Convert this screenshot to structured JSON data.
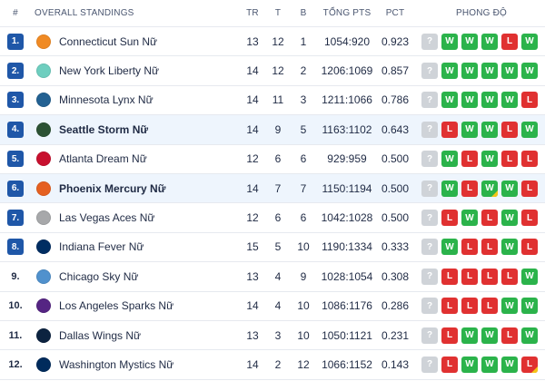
{
  "header": {
    "rank": "#",
    "title": "OVERALL STANDINGS",
    "played": "TR",
    "wins": "T",
    "losses": "B",
    "points": "TỔNG PTS",
    "pct": "PCT",
    "form": "PHONG ĐỘ"
  },
  "colors": {
    "rank_badge": "#1f57a8",
    "win": "#2bb34b",
    "loss": "#e03131",
    "unknown": "#cfd3d8",
    "highlight_row": "#eef5fd",
    "partial_marker": "#f5c518"
  },
  "teams": [
    {
      "rank": "1.",
      "badge": true,
      "name": "Connecticut Sun Nữ",
      "bold": false,
      "highlight": false,
      "logo": "sun-logo-icon",
      "logo_color": "#f08a24",
      "tr": "13",
      "t": "12",
      "b": "1",
      "pts": "1054:920",
      "pct": "0.923",
      "form": [
        "?",
        "W",
        "W",
        "W",
        "L",
        "W"
      ]
    },
    {
      "rank": "2.",
      "badge": true,
      "name": "New York Liberty Nữ",
      "bold": false,
      "highlight": false,
      "logo": "liberty-logo-icon",
      "logo_color": "#6ecebf",
      "tr": "14",
      "t": "12",
      "b": "2",
      "pts": "1206:1069",
      "pct": "0.857",
      "form": [
        "?",
        "W",
        "W",
        "W",
        "W",
        "W"
      ]
    },
    {
      "rank": "3.",
      "badge": true,
      "name": "Minnesota Lynx Nữ",
      "bold": false,
      "highlight": false,
      "logo": "lynx-logo-icon",
      "logo_color": "#236192",
      "tr": "14",
      "t": "11",
      "b": "3",
      "pts": "1211:1066",
      "pct": "0.786",
      "form": [
        "?",
        "W",
        "W",
        "W",
        "W",
        "L"
      ]
    },
    {
      "rank": "4.",
      "badge": true,
      "name": "Seattle Storm Nữ",
      "bold": true,
      "highlight": true,
      "logo": "storm-logo-icon",
      "logo_color": "#2c5234",
      "tr": "14",
      "t": "9",
      "b": "5",
      "pts": "1163:1102",
      "pct": "0.643",
      "form": [
        "?",
        "L",
        "W",
        "W",
        "L",
        "W"
      ]
    },
    {
      "rank": "5.",
      "badge": true,
      "name": "Atlanta Dream Nữ",
      "bold": false,
      "highlight": false,
      "logo": "dream-logo-icon",
      "logo_color": "#c8102e",
      "tr": "12",
      "t": "6",
      "b": "6",
      "pts": "929:959",
      "pct": "0.500",
      "form": [
        "?",
        "W",
        "L",
        "W",
        "L",
        "L"
      ]
    },
    {
      "rank": "6.",
      "badge": true,
      "name": "Phoenix Mercury Nữ",
      "bold": true,
      "highlight": true,
      "logo": "mercury-logo-icon",
      "logo_color": "#e56020",
      "tr": "14",
      "t": "7",
      "b": "7",
      "pts": "1150:1194",
      "pct": "0.500",
      "form": [
        "?",
        "W",
        "L",
        "W",
        "W",
        "L"
      ],
      "partial": [
        3
      ]
    },
    {
      "rank": "7.",
      "badge": true,
      "name": "Las Vegas Aces Nữ",
      "bold": false,
      "highlight": false,
      "logo": "aces-logo-icon",
      "logo_color": "#a7a8aa",
      "tr": "12",
      "t": "6",
      "b": "6",
      "pts": "1042:1028",
      "pct": "0.500",
      "form": [
        "?",
        "L",
        "W",
        "L",
        "W",
        "L"
      ]
    },
    {
      "rank": "8.",
      "badge": true,
      "name": "Indiana Fever Nữ",
      "bold": false,
      "highlight": false,
      "logo": "fever-logo-icon",
      "logo_color": "#002d62",
      "tr": "15",
      "t": "5",
      "b": "10",
      "pts": "1190:1334",
      "pct": "0.333",
      "form": [
        "?",
        "W",
        "L",
        "L",
        "W",
        "L"
      ]
    },
    {
      "rank": "9.",
      "badge": false,
      "name": "Chicago Sky Nữ",
      "bold": false,
      "highlight": false,
      "logo": "sky-logo-icon",
      "logo_color": "#5091cd",
      "tr": "13",
      "t": "4",
      "b": "9",
      "pts": "1028:1054",
      "pct": "0.308",
      "form": [
        "?",
        "L",
        "L",
        "L",
        "L",
        "W"
      ]
    },
    {
      "rank": "10.",
      "badge": false,
      "name": "Los Angeles Sparks Nữ",
      "bold": false,
      "highlight": false,
      "logo": "sparks-logo-icon",
      "logo_color": "#552583",
      "tr": "14",
      "t": "4",
      "b": "10",
      "pts": "1086:1176",
      "pct": "0.286",
      "form": [
        "?",
        "L",
        "L",
        "L",
        "W",
        "W"
      ]
    },
    {
      "rank": "11.",
      "badge": false,
      "name": "Dallas Wings Nữ",
      "bold": false,
      "highlight": false,
      "logo": "wings-logo-icon",
      "logo_color": "#0c2340",
      "tr": "13",
      "t": "3",
      "b": "10",
      "pts": "1050:1121",
      "pct": "0.231",
      "form": [
        "?",
        "L",
        "W",
        "W",
        "L",
        "W"
      ]
    },
    {
      "rank": "12.",
      "badge": false,
      "name": "Washington Mystics Nữ",
      "bold": false,
      "highlight": false,
      "logo": "mystics-logo-icon",
      "logo_color": "#002b5c",
      "tr": "14",
      "t": "2",
      "b": "12",
      "pts": "1066:1152",
      "pct": "0.143",
      "form": [
        "?",
        "L",
        "W",
        "W",
        "W",
        "L"
      ],
      "partial": [
        5
      ]
    }
  ]
}
